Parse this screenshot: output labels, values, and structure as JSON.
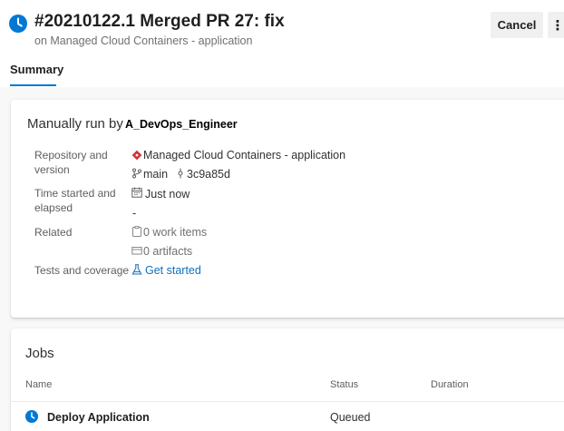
{
  "header": {
    "title": "#20210122.1 Merged PR 27: fix",
    "subtitle": "on Managed Cloud Containers - application",
    "cancel_label": "Cancel",
    "more_label": "⋮",
    "status_icon": "clock-icon",
    "status_color": "#0078d4"
  },
  "tabs": [
    {
      "label": "Summary",
      "selected": true
    }
  ],
  "summary": {
    "manual_prefix": "Manually run by",
    "manual_user": "A_DevOps_Engineer",
    "repository": {
      "label": "Repository and version",
      "repo_name": "Managed Cloud Containers - application",
      "repo_icon": "git-repo-icon",
      "branch": "main",
      "branch_icon": "branch-icon",
      "commit": "3c9a85d",
      "commit_icon": "commit-icon"
    },
    "time": {
      "label": "Time started and elapsed",
      "started": "Just now",
      "calendar_icon": "calendar-icon",
      "elapsed": "-"
    },
    "related": {
      "label": "Related",
      "work_items": "0 work items",
      "work_items_icon": "work-item-icon",
      "artifacts": "0 artifacts",
      "artifacts_icon": "artifact-icon"
    },
    "tests": {
      "label": "Tests and coverage",
      "link": "Get started",
      "link_icon": "flask-icon"
    }
  },
  "jobs": {
    "title": "Jobs",
    "columns": [
      "Name",
      "Status",
      "Duration"
    ],
    "rows": [
      {
        "name": "Deploy Application",
        "status": "Queued",
        "duration": "",
        "icon": "clock-icon"
      }
    ]
  },
  "colors": {
    "accent": "#0078d4",
    "repo_red": "#d13438",
    "link": "#106ebe"
  }
}
